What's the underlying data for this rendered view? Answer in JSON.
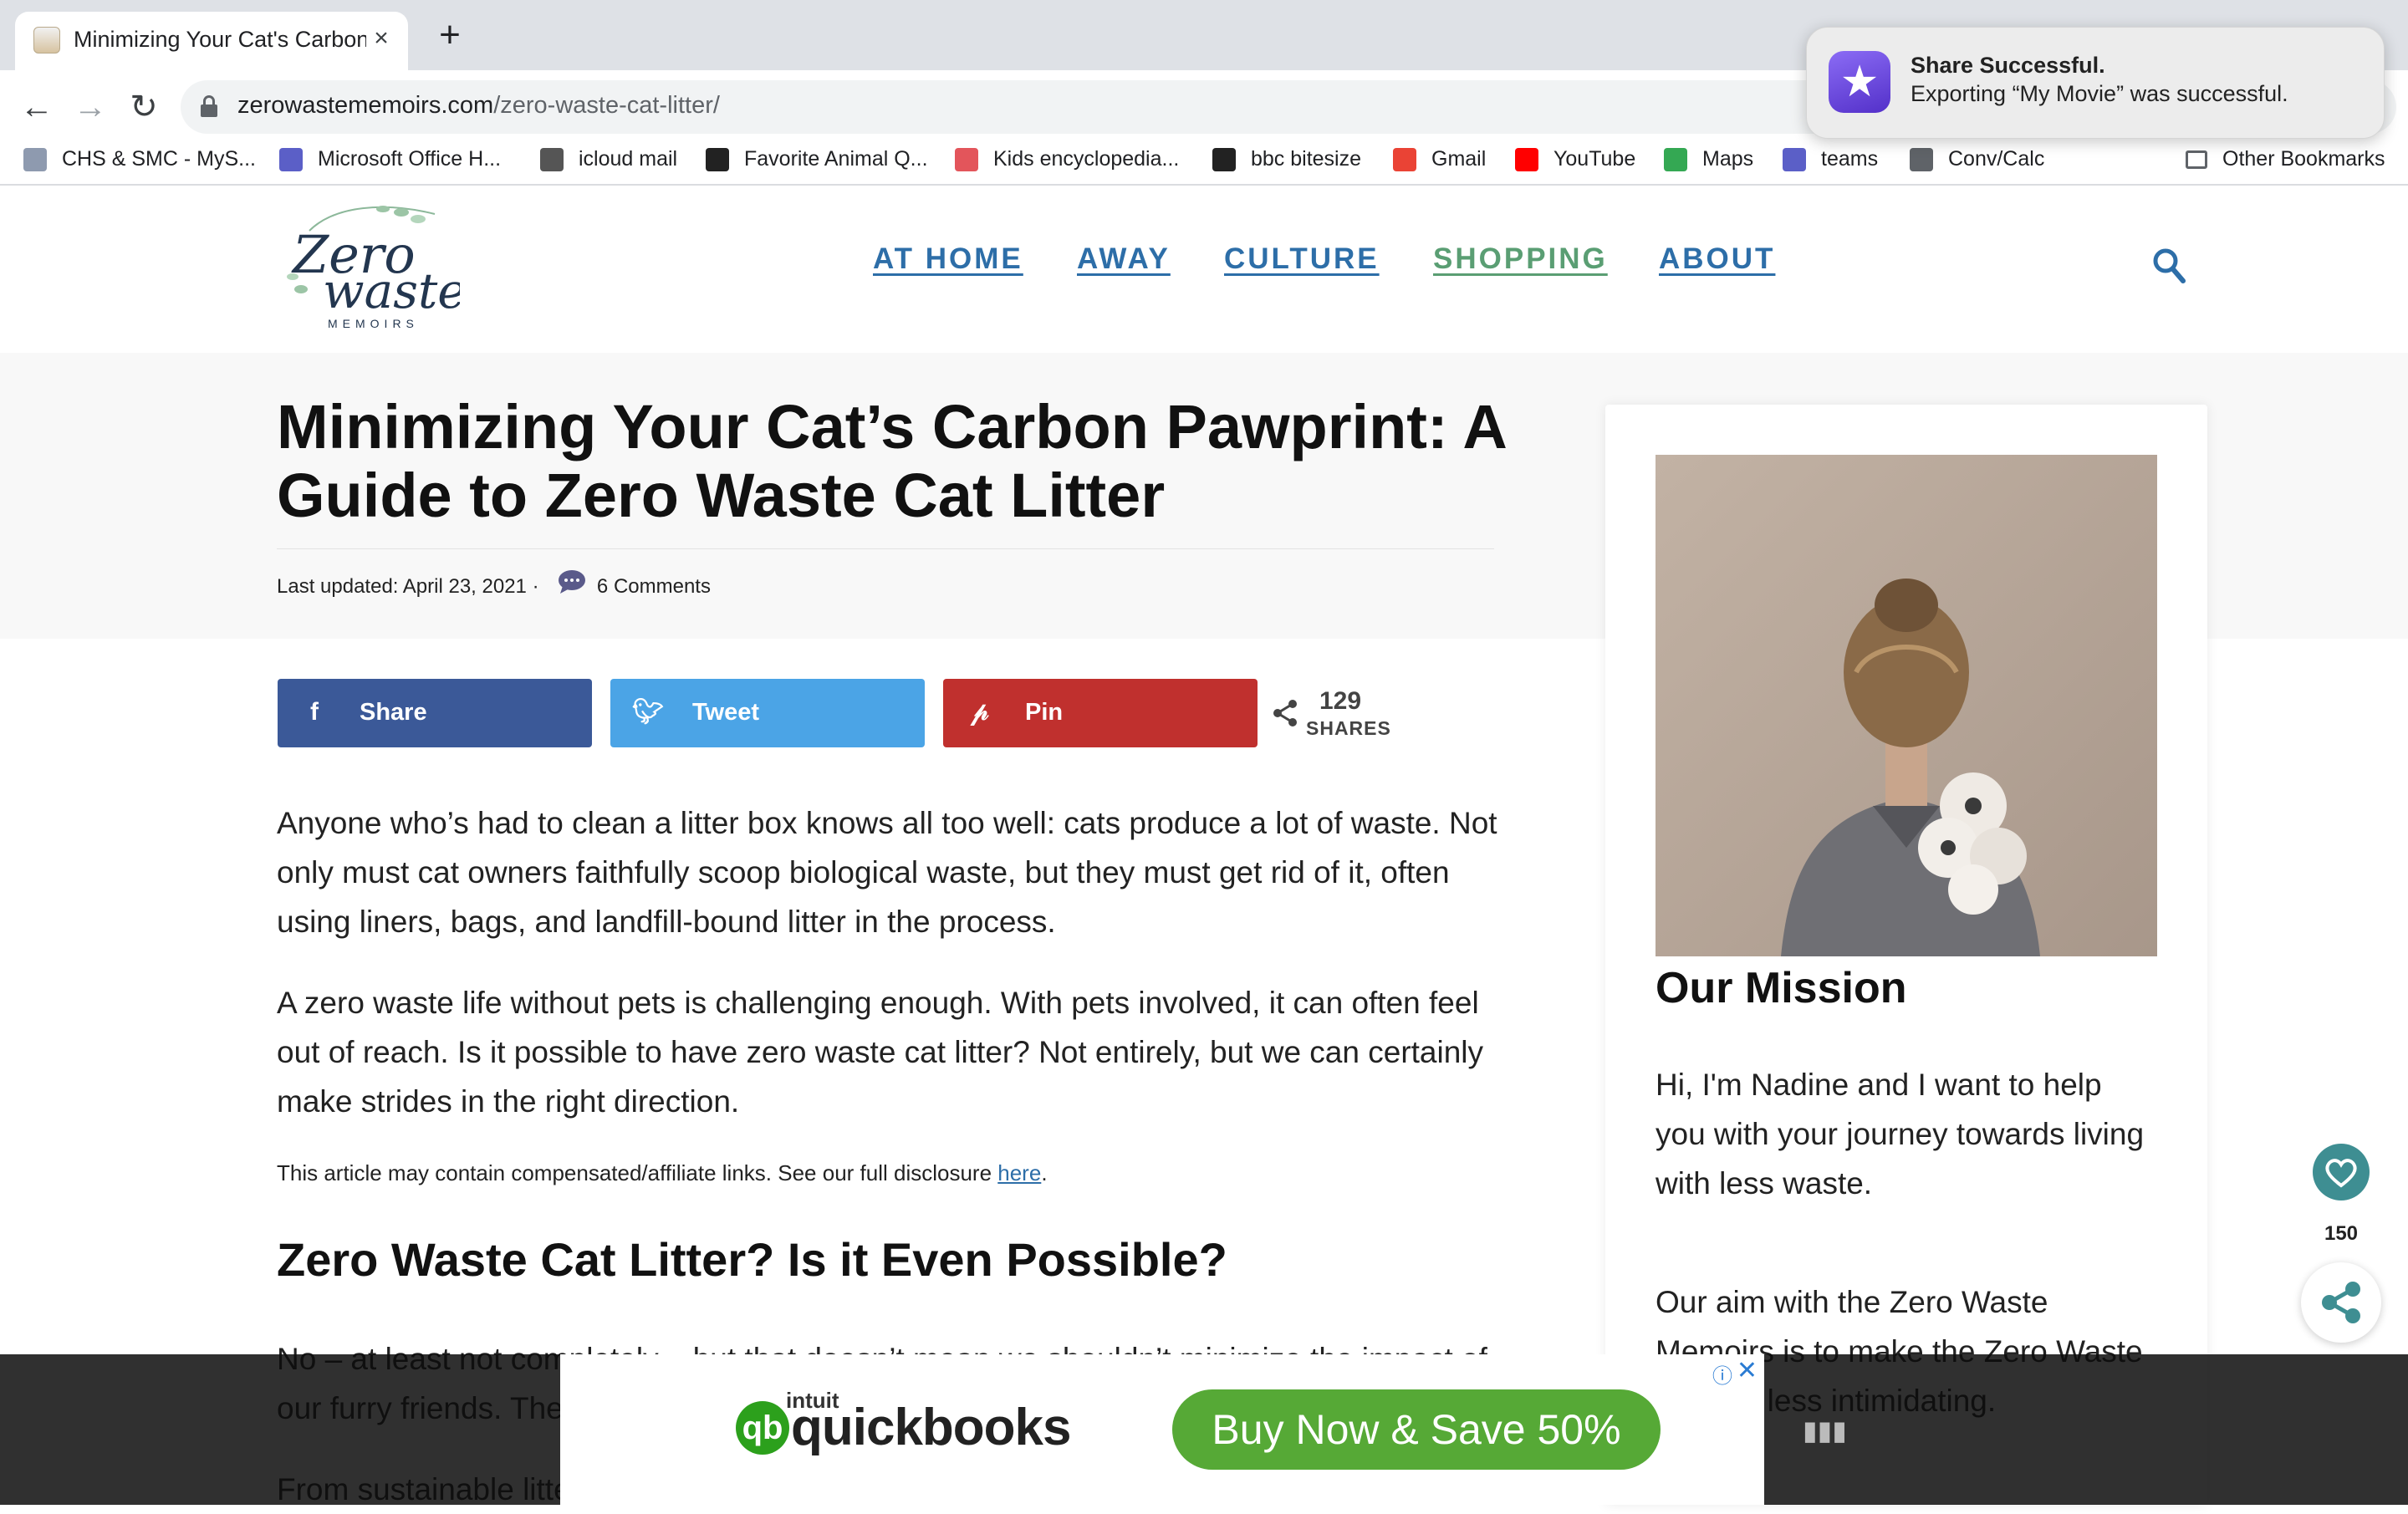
{
  "browser": {
    "tab_title": "Minimizing Your Cat's Carbon P",
    "url_host": "zerowastememoirs.com",
    "url_path": "/zero-waste-cat-litter/",
    "bookmarks": [
      {
        "label": "CHS & SMC - MyS...",
        "icon": "bars-icon",
        "color": "#8e9aaf"
      },
      {
        "label": "Microsoft Office H...",
        "icon": "office-icon",
        "color": "#5b5fc7"
      },
      {
        "label": "icloud mail",
        "icon": "apple-icon",
        "color": "#555555"
      },
      {
        "label": "Favorite Animal Q...",
        "icon": "quiz-icon",
        "color": "#222222"
      },
      {
        "label": "Kids encyclopedia...",
        "icon": "encyclopedia-icon",
        "color": "#e3555b"
      },
      {
        "label": "bbc bitesize",
        "icon": "bbc-icon",
        "color": "#222222"
      },
      {
        "label": "Gmail",
        "icon": "gmail-icon",
        "color": "#ea4335"
      },
      {
        "label": "YouTube",
        "icon": "youtube-icon",
        "color": "#ff0000"
      },
      {
        "label": "Maps",
        "icon": "maps-icon",
        "color": "#34a853"
      },
      {
        "label": "teams",
        "icon": "teams-icon",
        "color": "#5b5fc7"
      },
      {
        "label": "Conv/Calc",
        "icon": "folder-icon",
        "color": "#5f6368"
      }
    ],
    "overflow_label": "»",
    "other_bookmarks": "Other Bookmarks"
  },
  "notification": {
    "title": "Share Successful.",
    "body": "Exporting “My Movie” was successful."
  },
  "site": {
    "nav": [
      "AT HOME",
      "AWAY",
      "CULTURE",
      "SHOPPING",
      "ABOUT"
    ],
    "accent": "#2d6ea8",
    "shop_color": "#5a9e73"
  },
  "article": {
    "title": "Minimizing Your Cat’s Carbon Pawprint: A Guide to Zero Waste Cat Litter",
    "last_updated": "Last updated: April 23, 2021",
    "meta_sep": "·",
    "comments": "6 Comments",
    "share_buttons": [
      {
        "label": "Share",
        "icon": "facebook-icon",
        "color": "#3b5998"
      },
      {
        "label": "Tweet",
        "icon": "twitter-icon",
        "color": "#4ba4e6"
      },
      {
        "label": "Pin",
        "icon": "pinterest-icon",
        "color": "#c0302e"
      }
    ],
    "share_count": "129",
    "share_count_label": "SHARES",
    "paragraph1": "Anyone who’s had to clean a litter box knows all too well: cats produce a lot of waste. Not only must cat owners faithfully scoop biological waste, but they must get rid of it, often using liners, bags, and landfill-bound litter in the process.",
    "paragraph2": "A zero waste life without pets is challenging enough. With pets involved, it can often feel out of reach. Is it possible to have zero waste cat litter? Not entirely, but we can certainly make strides in the right direction.",
    "disclosure_text": "This article may contain compensated/affiliate links. See our full disclosure ",
    "disclosure_link": "here",
    "disclosure_end": ".",
    "heading2": "Zero Waste Cat Litter? Is it Even Possible?",
    "paragraph3": "No – at least not completely – but that doesn’t mean we shouldn’t minimize the impact of our furry friends. The",
    "paragraph4": "From sustainable litte"
  },
  "sidebar": {
    "title": "Our Mission",
    "p1": "Hi, I'm Nadine and I want to help you with your journey towards living with less waste.",
    "p2": "Our aim with the Zero Waste Memoirs is to make the Zero Waste lifestyle less intimidating."
  },
  "floating": {
    "count": "150"
  },
  "ad": {
    "brand_small": "intuit",
    "brand": "quickbooks",
    "cta": "Buy Now & Save 50%",
    "info": "ⓘ",
    "close": "✕"
  }
}
